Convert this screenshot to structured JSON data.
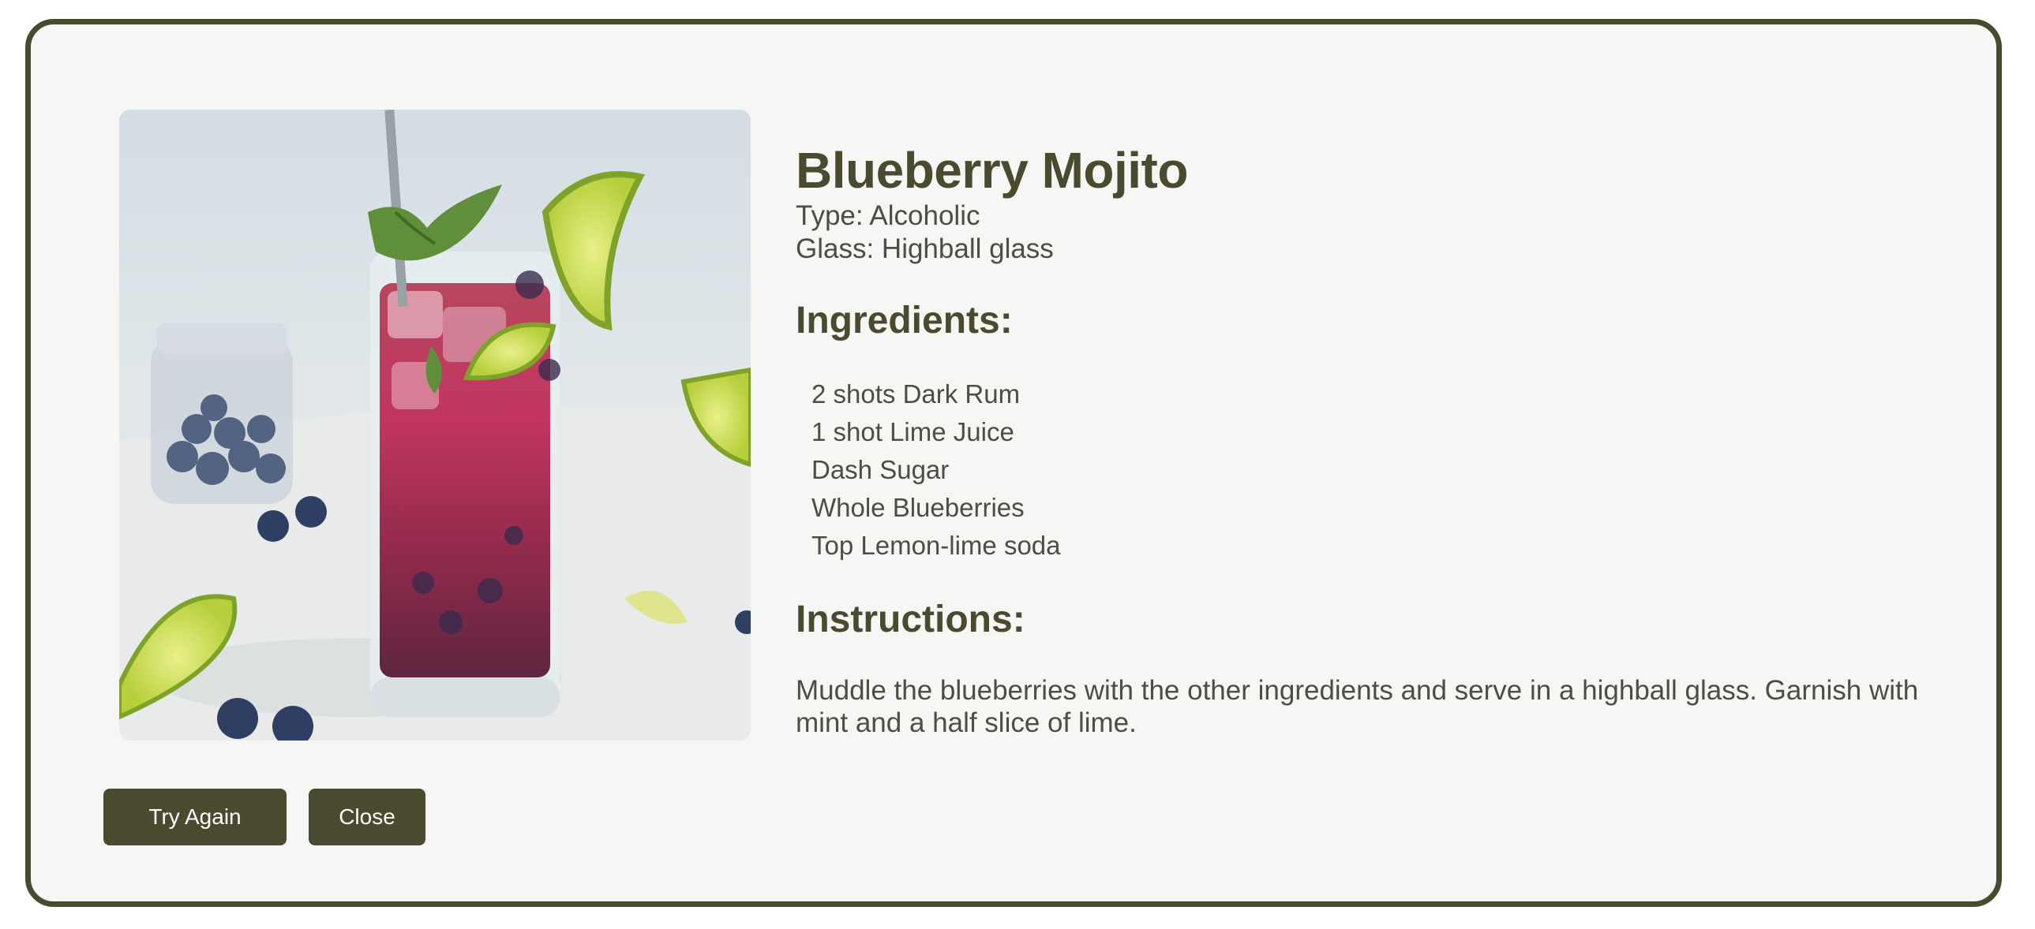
{
  "drink": {
    "name": "Blueberry Mojito",
    "type": "Type: Alcoholic",
    "glass": "Glass: Highball glass",
    "image_icon": "cocktail-photo"
  },
  "ingredients": {
    "heading": "Ingredients:",
    "items": [
      "2 shots Dark Rum",
      "1 shot Lime Juice",
      "Dash Sugar",
      "Whole Blueberries",
      "Top Lemon-lime soda"
    ]
  },
  "instructions": {
    "heading": "Instructions:",
    "text": "Muddle the blueberries with the other ingredients and serve in a highball glass. Garnish with mint and a half slice of lime."
  },
  "buttons": {
    "try_again": "Try Again",
    "close": "Close"
  },
  "colors": {
    "accent": "#4a4a2f",
    "card_bg": "#f6f6f4",
    "text": "#4d4d46"
  }
}
